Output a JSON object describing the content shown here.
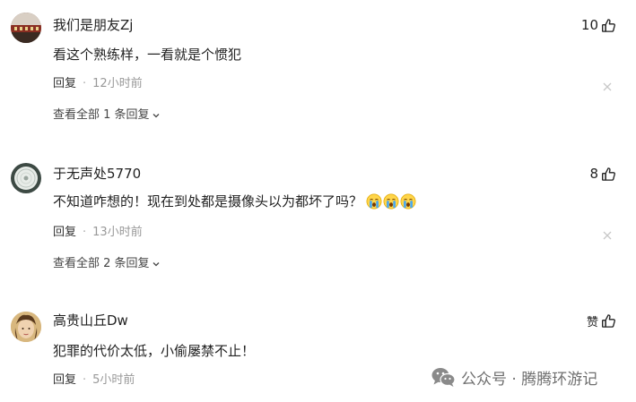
{
  "comments": [
    {
      "username": "我们是朋友Zj",
      "likes": "10",
      "text": "看这个熟练样，一看就是个惯犯",
      "reply_label": "回复",
      "separator": "·",
      "time": "12小时前",
      "view_all_label": "查看全部 1 条回复"
    },
    {
      "username": "于无声处5770",
      "likes": "8",
      "text": "不知道咋想的！现在到处都是摄像头以为都坏了吗？",
      "reply_label": "回复",
      "separator": "·",
      "time": "13小时前",
      "view_all_label": "查看全部 2 条回复",
      "emojis": [
        "crying-emoji",
        "crying-emoji",
        "crying-emoji"
      ]
    },
    {
      "username": "高贵山丘Dw",
      "likes": "赞",
      "text": "犯罪的代价太低，小偷屡禁不止！",
      "reply_label": "回复",
      "separator": "·",
      "time": "5小时前"
    }
  ],
  "watermark": {
    "text": "公众号 · 腾腾环游记",
    "icon": "wechat-icon"
  },
  "colors": {
    "text_primary": "#222222",
    "text_secondary": "#999999",
    "watermark": "#6f6f6f"
  }
}
